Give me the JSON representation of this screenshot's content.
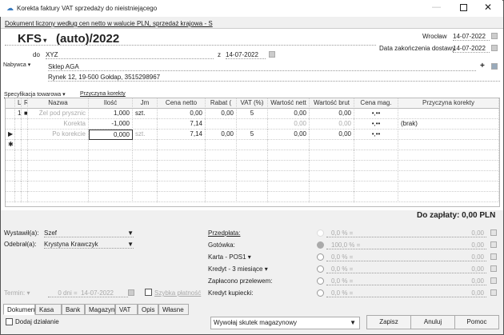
{
  "window": {
    "title": "Korekta faktury VAT sprzedaży do nieistniejącego",
    "info_link": "Dokument liczony według cen netto w walucie PLN, sprzedaż krajowa - S"
  },
  "header": {
    "doc_type": "KFS",
    "number": "(auto)/2022",
    "city": "Wrocław",
    "issue_date": "14-07-2022",
    "delivery_label": "Data zakończenia dostawy",
    "delivery_date": "14-07-2022",
    "do_label": "do",
    "do_value": "XYZ",
    "z_label": "z",
    "z_date": "14-07-2022",
    "buyer_label": "Nabywca",
    "buyer_name": "Sklep AGA",
    "buyer_address": "Rynek 12, 19-500 Gołdap, 3515298967",
    "add_icon": "+"
  },
  "tabs_top": {
    "spec": "Specyfikacja towarowa",
    "reason": "Przyczyna korekty"
  },
  "table": {
    "columns": [
      "",
      "L",
      "R",
      "Nazwa",
      "Ilość",
      "Jm",
      "Cena netto",
      "Rabat (",
      "VAT (%)",
      "Wartość nett",
      "Wartość brut",
      "Cena mag.",
      "Przyczyna korekty"
    ],
    "rows": [
      [
        "",
        "1",
        "■",
        "Żel pod prysznic",
        "1,000",
        "szt.",
        "0,00",
        "0,00",
        "5",
        "0,00",
        "0,00",
        "•,••",
        ""
      ],
      [
        "",
        "",
        "",
        "Korekta",
        "-1,000",
        "",
        "7,14",
        "",
        "",
        "0,00",
        "0,00",
        "•,••",
        "(brak)"
      ],
      [
        "▶",
        "",
        "",
        "Po korekcie",
        "0,000",
        "szt.",
        "7,14",
        "0,00",
        "5",
        "0,00",
        "0,00",
        "•,••",
        ""
      ],
      [
        "✱",
        "",
        "",
        "",
        "",
        "",
        "",
        "",
        "",
        "",
        "",
        "",
        ""
      ]
    ]
  },
  "total": "Do zapłaty: 0,00 PLN",
  "people": {
    "issued_label": "Wystawił(a):",
    "issued": "Szef",
    "received_label": "Odebrał(a):",
    "received": "Krystyna Krawczyk"
  },
  "term": {
    "label": "Termin:",
    "days": "0 dni =",
    "date": "14-07-2022",
    "quick": "Szybka płatność"
  },
  "payments": [
    {
      "label": "Przedpłata:",
      "pct": "0,0 % =",
      "amount": "0,00"
    },
    {
      "label": "Gotówka:",
      "pct": "100,0 % =",
      "amount": "0,00"
    },
    {
      "label": "Karta - POS1",
      "pct": "0,0 % =",
      "amount": "0,00"
    },
    {
      "label": "Kredyt - 3 miesiące",
      "pct": "0,0 % =",
      "amount": "0,00"
    },
    {
      "label": "Zapłacono przelewem:",
      "pct": "0,0 % =",
      "amount": "0,00"
    },
    {
      "label": "Kredyt kupiecki:",
      "pct": "0,0 % =",
      "amount": "0,00"
    }
  ],
  "bottom_tabs": [
    "Dokument",
    "Kasa",
    "Bank",
    "Magazyn",
    "VAT",
    "Opis",
    "Własne"
  ],
  "footer": {
    "add_action": "Dodaj działanie",
    "stock_action": "Wywołaj skutek magazynowy",
    "save": "Zapisz",
    "cancel": "Anuluj",
    "help": "Pomoc"
  }
}
